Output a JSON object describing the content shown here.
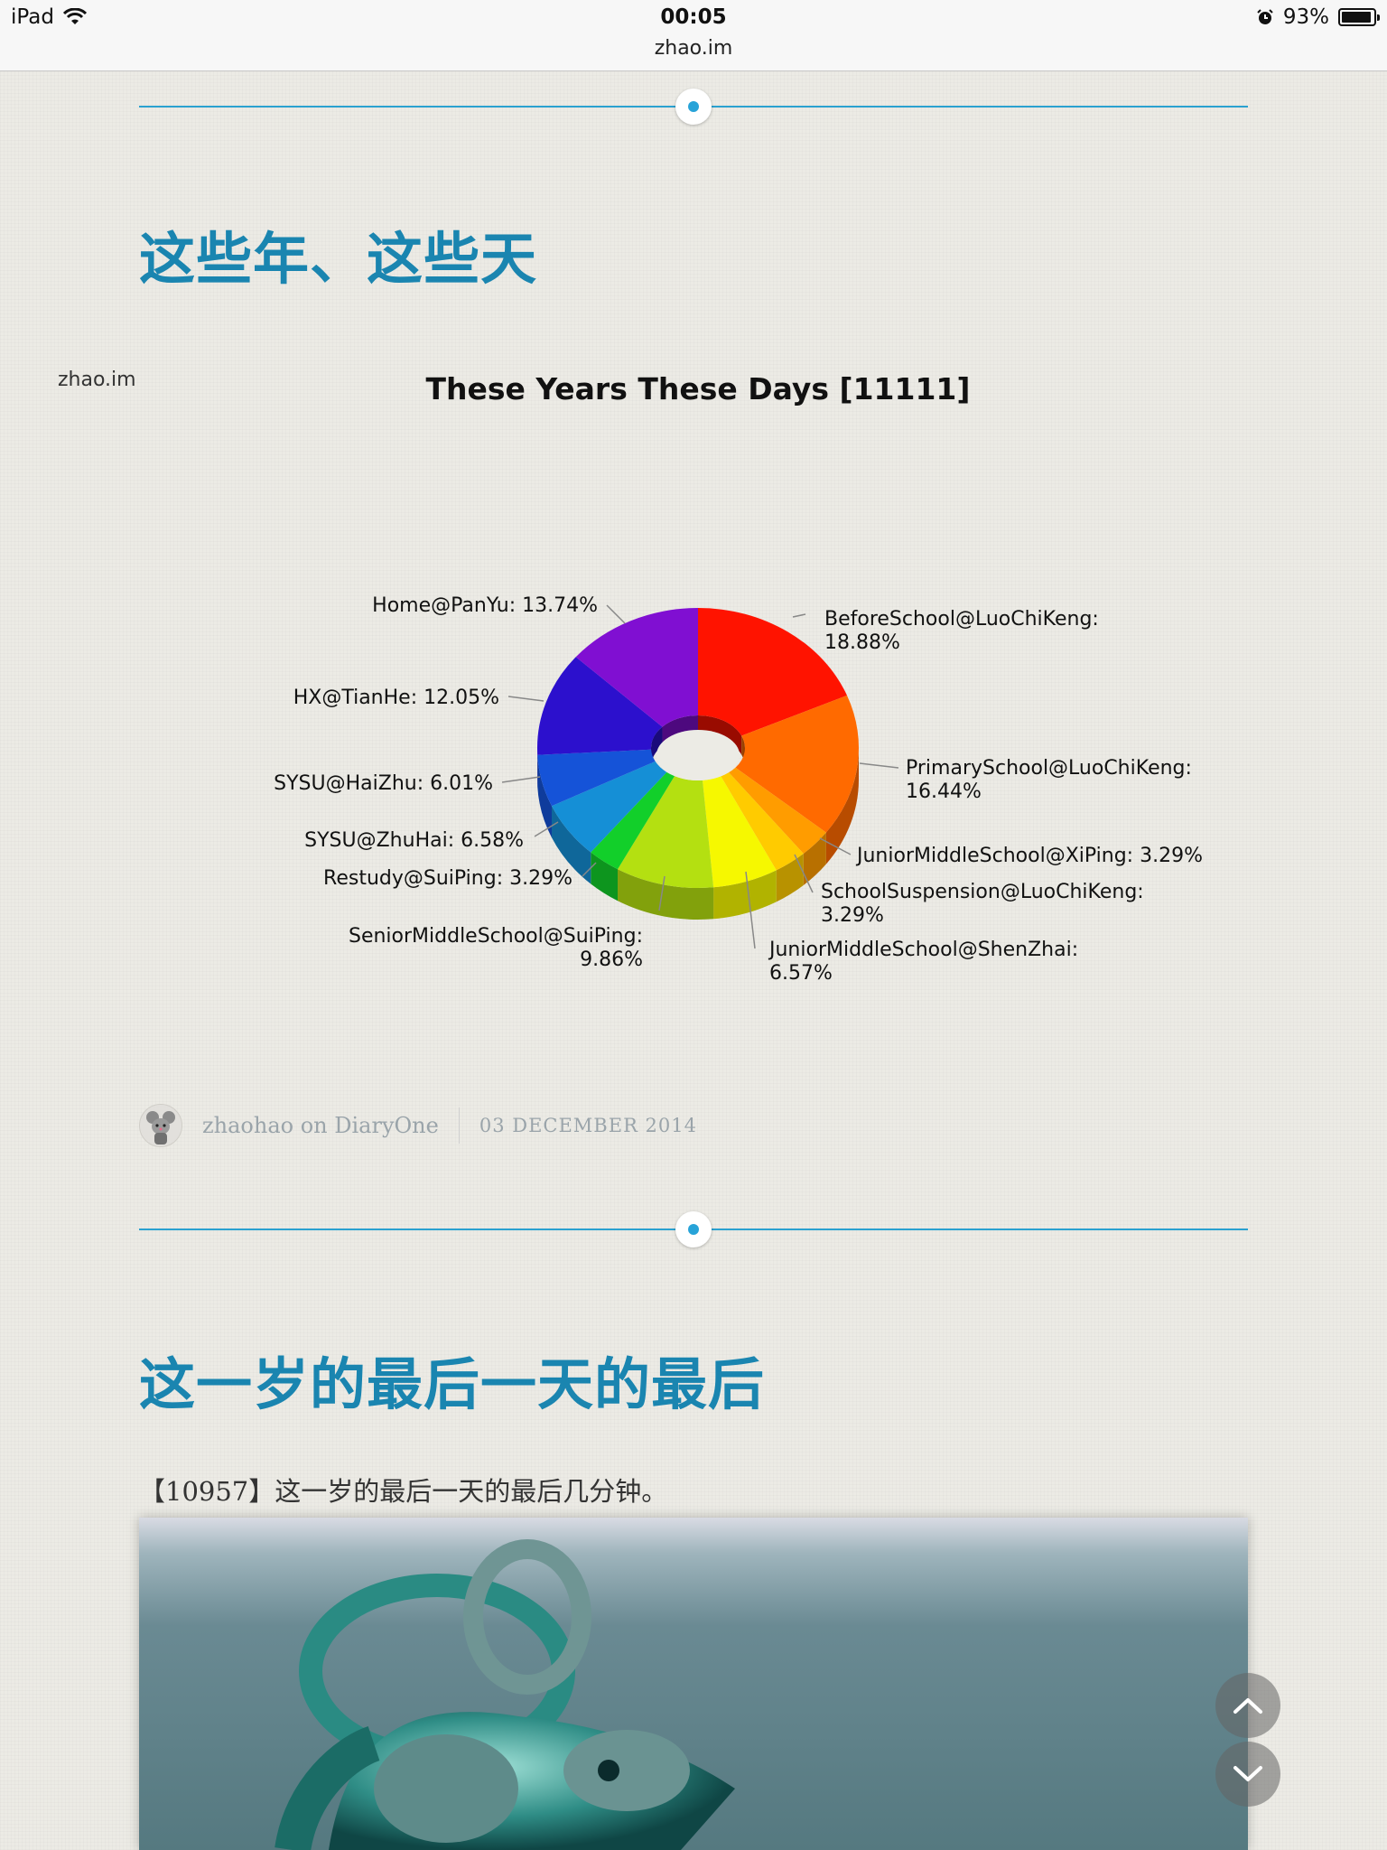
{
  "status_bar": {
    "device": "iPad",
    "time": "00:05",
    "url": "zhao.im",
    "battery": "93%",
    "battery_level": 0.93
  },
  "posts": [
    {
      "title": "这些年、这些天",
      "watermark": "zhao.im",
      "author": "zhaohao on DiaryOne",
      "date": "03 DECEMBER 2014"
    },
    {
      "title": "这一岁的最后一天的最后",
      "excerpt": "【10957】这一岁的最后一天的最后几分钟。"
    }
  ],
  "chart_data": {
    "type": "pie",
    "title": "These Years These Days [11111]",
    "slices": [
      {
        "label": "BeforeSchool@LuoChiKeng:",
        "pct": "18.88%",
        "value": 18.88,
        "color": "#ff1300"
      },
      {
        "label": "PrimarySchool@LuoChiKeng:",
        "pct": "16.44%",
        "value": 16.44,
        "color": "#ff6a00"
      },
      {
        "label": "JuniorMiddleSchool@XiPing: 3.29%",
        "pct": "",
        "value": 3.29,
        "color": "#ff9c00"
      },
      {
        "label": "SchoolSuspension@LuoChiKeng:",
        "pct": "3.29%",
        "value": 3.29,
        "color": "#ffcb00"
      },
      {
        "label": "JuniorMiddleSchool@ShenZhai:",
        "pct": "6.57%",
        "value": 6.57,
        "color": "#f6f800"
      },
      {
        "label": "SeniorMiddleSchool@SuiPing:",
        "pct": "9.86%",
        "value": 9.86,
        "color": "#b4e011"
      },
      {
        "label": "Restudy@SuiPing: 3.29%",
        "pct": "",
        "value": 3.29,
        "color": "#12cf2a"
      },
      {
        "label": "SYSU@ZhuHai: 6.58%",
        "pct": "",
        "value": 6.58,
        "color": "#158fd6"
      },
      {
        "label": "SYSU@HaiZhu: 6.01%",
        "pct": "",
        "value": 6.01,
        "color": "#1553d8"
      },
      {
        "label": "HX@TianHe: 12.05%",
        "pct": "",
        "value": 12.05,
        "color": "#2c10cd"
      },
      {
        "label": "Home@PanYu: 13.74%",
        "pct": "",
        "value": 13.74,
        "color": "#800fd2"
      }
    ]
  }
}
